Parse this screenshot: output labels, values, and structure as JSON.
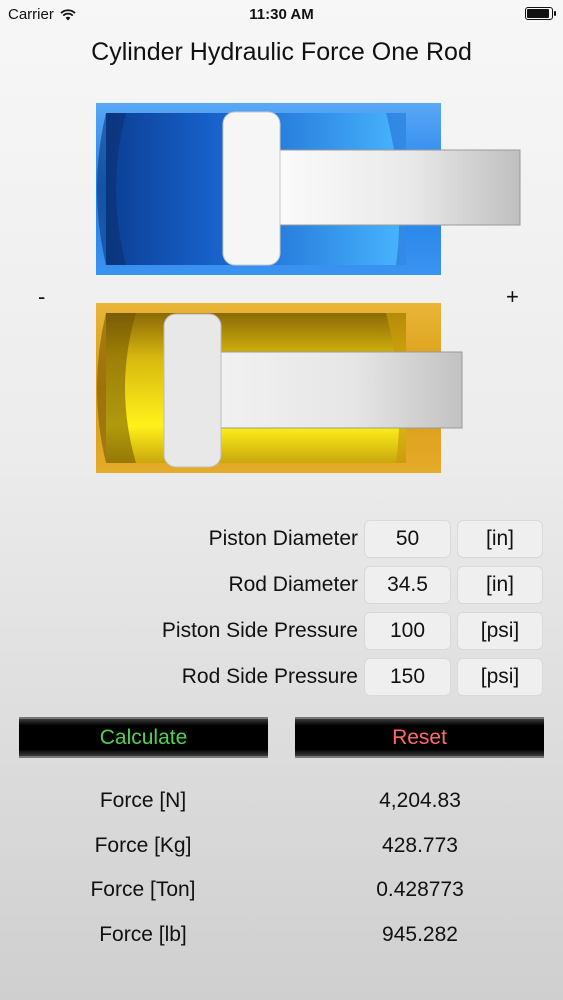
{
  "status_bar": {
    "carrier": "Carrier",
    "time": "11:30 AM"
  },
  "title": "Cylinder Hydraulic Force One Rod",
  "diagram": {
    "minus_label": "-",
    "plus_label": "+"
  },
  "inputs": [
    {
      "label": "Piston Diameter",
      "value": "50",
      "unit": "[in]"
    },
    {
      "label": "Rod Diameter",
      "value": "34.5",
      "unit": "[in]"
    },
    {
      "label": "Piston Side Pressure",
      "value": "100",
      "unit": "[psi]"
    },
    {
      "label": "Rod Side Pressure",
      "value": "150",
      "unit": "[psi]"
    }
  ],
  "buttons": {
    "calculate": "Calculate",
    "reset": "Reset"
  },
  "results": [
    {
      "label": "Force [N]",
      "value": "4,204.83"
    },
    {
      "label": "Force [Kg]",
      "value": "428.773"
    },
    {
      "label": "Force [Ton]",
      "value": "0.428773"
    },
    {
      "label": "Force [lb]",
      "value": "945.282"
    }
  ],
  "colors": {
    "calculate_text": "#4fd34f",
    "reset_text": "#ff6b6b",
    "blue_cylinder": "#2f8ef0",
    "yellow_cylinder": "#e0a51f"
  }
}
